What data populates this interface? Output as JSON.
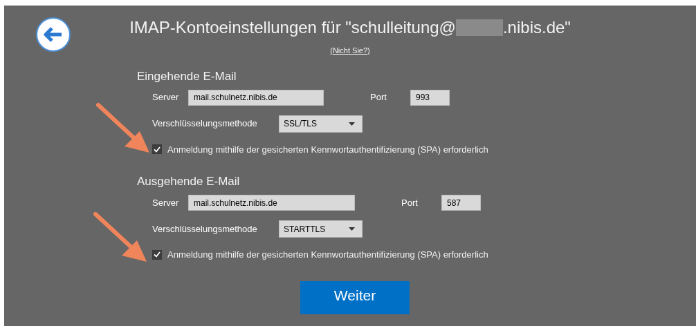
{
  "title": {
    "prefix": "IMAP-Kontoeinstellungen für \"schulleitung@",
    "suffix": ".nibis.de\""
  },
  "not_you_link": "(Nicht Sie?)",
  "sections": [
    {
      "heading": "Eingehende E-Mail",
      "server_label": "Server",
      "server": "mail.schulnetz.nibis.de",
      "port_label": "Port",
      "port": "993",
      "encryption_label": "Verschlüsselungsmethode",
      "encryption": "SSL/TLS",
      "spa": {
        "label": "Anmeldung mithilfe der gesicherten Kennwortauthentifizierung (SPA) erforderlich",
        "checked": true
      }
    },
    {
      "heading": "Ausgehende E-Mail",
      "server_label": "Server",
      "server": "mail.schulnetz.nibis.de",
      "port_label": "Port",
      "port": "587",
      "encryption_label": "Verschlüsselungsmethode",
      "encryption": "STARTTLS",
      "spa": {
        "label": "Anmeldung mithilfe der gesicherten Kennwortauthentifizierung (SPA) erforderlich",
        "checked": true
      }
    }
  ],
  "next_button": "Weiter"
}
